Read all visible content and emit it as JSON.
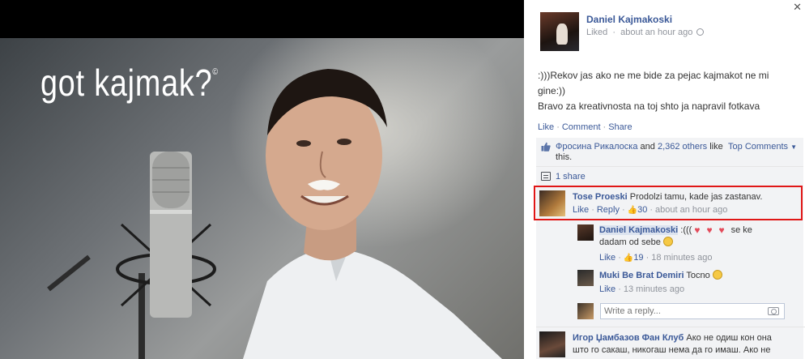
{
  "photo": {
    "caption": "got kajmak?",
    "caption_mark": "©"
  },
  "post": {
    "author": "Daniel Kajmakoski",
    "liked_label": "Liked",
    "time": "about an hour ago",
    "text_line1": ":)))Rekov jas ako ne me bide za pejac kajmakot ne mi",
    "text_line2": "gine:))",
    "text_line3": "Bravo za kreativnosta na toj shto ja napravil fotkava",
    "actions": {
      "like": "Like",
      "comment": "Comment",
      "share": "Share"
    }
  },
  "likes": {
    "first_liker": "Фросина Рикалоска",
    "and": "and",
    "others": "2,362 others",
    "suffix": "like this.",
    "sort_label": "Top Comments",
    "shares": "1 share"
  },
  "comments": [
    {
      "author": "Tose Proeski",
      "text": "Prodolzi tamu, kade jas zastanav.",
      "like": "Like",
      "reply": "Reply",
      "likes_count": "30",
      "time": "about an hour ago"
    },
    {
      "author": "Daniel Kajmakoski",
      "text_a": ":(((",
      "text_b": "se ke",
      "text_c": "dadam od sebe",
      "like": "Like",
      "likes_count": "19",
      "time": "18 minutes ago"
    },
    {
      "author": "Muki Be Brat Demiri",
      "text": "Tocno",
      "like": "Like",
      "time": "13 minutes ago"
    },
    {
      "author": "Игор Џамбазов Фан Клуб",
      "text_line1": "Ако не одиш кон она",
      "text_line2": "што го сакаш, никогаш нема да го имаш. Ако не"
    }
  ],
  "reply": {
    "placeholder": "Write a reply..."
  },
  "colors": {
    "link": "#3b5998",
    "highlight": "#e01616",
    "ufi_bg": "#f2f3f5"
  }
}
